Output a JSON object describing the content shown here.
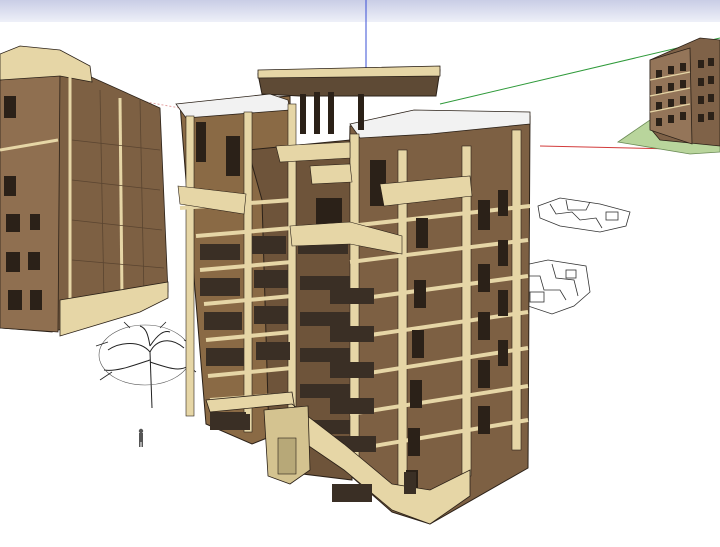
{
  "scene": {
    "background_color": "#ffffff",
    "sky_color": "#d6daef",
    "axis_colors": {
      "red": "#d23b3b",
      "green": "#2f9a3a",
      "blue": "#3a4fd6"
    },
    "material_colors": {
      "brick": "#8a6a45",
      "brick_dark": "#5e4a35",
      "stone_trim": "#e6d6a6",
      "stone_shadow": "#b7a878",
      "window": "#3a2f25",
      "roof": "#f2f2f2",
      "ground": "#b9d59c"
    },
    "objects": [
      {
        "id": "main-building",
        "type": "apartment-tower",
        "visible": true
      },
      {
        "id": "left-building",
        "type": "apartment-tower-partial",
        "visible": true
      },
      {
        "id": "far-building",
        "type": "apartment-block-distant",
        "visible": true
      },
      {
        "id": "tree",
        "type": "tree-2d-face-me",
        "visible": true
      },
      {
        "id": "person",
        "type": "scale-figure",
        "visible": true
      },
      {
        "id": "floor-plans",
        "type": "2d-plan-drawings",
        "visible": true
      }
    ]
  }
}
